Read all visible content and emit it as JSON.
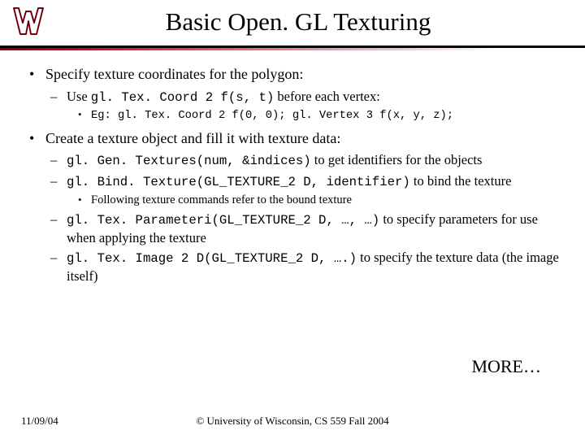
{
  "title": "Basic Open. GL Texturing",
  "b1": {
    "text": "Specify texture coordinates for the polygon:",
    "s1": {
      "pre": "Use ",
      "code": "gl. Tex. Coord 2 f(s, t)",
      "post": " before each vertex:",
      "eg": "Eg: gl. Tex. Coord 2 f(0, 0); gl. Vertex 3 f(x, y, z);"
    }
  },
  "b2": {
    "text": "Create a texture object and fill it with texture data:",
    "s1": {
      "code": "gl. Gen. Textures(num, &indices)",
      "post": " to get identifiers for the objects"
    },
    "s2": {
      "code": "gl. Bind. Texture(GL_TEXTURE_2 D, identifier)",
      "post": " to bind the texture",
      "sub": "Following texture commands refer to the bound texture"
    },
    "s3": {
      "code": "gl. Tex. Parameteri(GL_TEXTURE_2 D, …, …)",
      "post": " to specify parameters for use when applying the texture"
    },
    "s4": {
      "code": "gl. Tex. Image 2 D(GL_TEXTURE_2 D, ….)",
      "post": " to specify the texture data (the image itself)"
    }
  },
  "more": "MORE…",
  "footer": {
    "date": "11/09/04",
    "copy": "© University of Wisconsin, CS 559 Fall 2004"
  }
}
